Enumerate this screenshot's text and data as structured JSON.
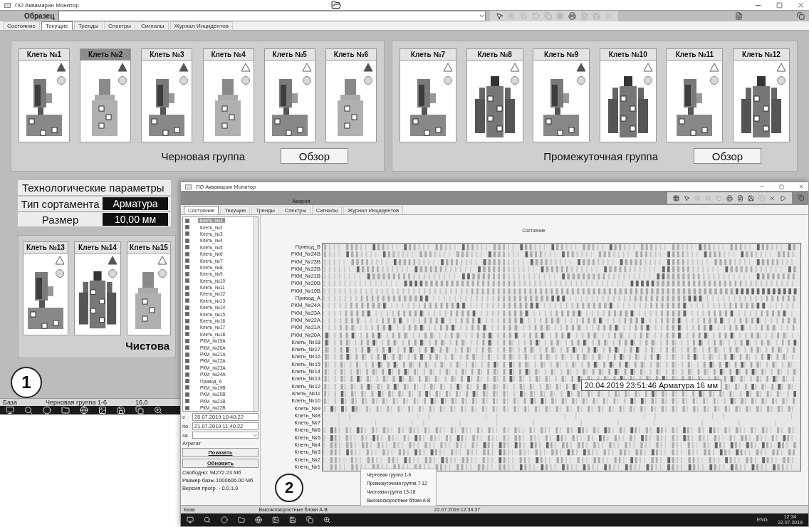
{
  "window1": {
    "title": "ПО Аквамарин Монитор",
    "sample_label": "Образец",
    "tabs": [
      {
        "label": "Состояние",
        "selected": false
      },
      {
        "label": "Текущие",
        "selected": true
      },
      {
        "label": "Тренды",
        "selected": false
      },
      {
        "label": "Спектры",
        "selected": false
      },
      {
        "label": "Сигналы",
        "selected": false
      },
      {
        "label": "Журнал Инцидентов",
        "selected": false
      }
    ],
    "groups": [
      {
        "name": "Черновая группа",
        "button": "Обзор",
        "stands": [
          {
            "label": "Клеть №1",
            "kind": "horizontal",
            "selected": false,
            "alarm": true
          },
          {
            "label": "Клеть №2",
            "kind": "vertical",
            "selected": true,
            "alarm": true
          },
          {
            "label": "Клеть №3",
            "kind": "horizontal",
            "selected": false,
            "alarm": true
          },
          {
            "label": "Клеть №4",
            "kind": "vertical",
            "selected": false,
            "alarm": false
          },
          {
            "label": "Клеть №5",
            "kind": "horizontal",
            "selected": false,
            "alarm": false
          },
          {
            "label": "Клеть №6",
            "kind": "vertical",
            "selected": false,
            "alarm": true
          }
        ]
      },
      {
        "name": "Промежуточная группа",
        "button": "Обзор",
        "stands": [
          {
            "label": "Клеть №7",
            "kind": "horizontal",
            "selected": false,
            "alarm": false
          },
          {
            "label": "Клеть №8",
            "kind": "frame",
            "selected": false,
            "alarm": false
          },
          {
            "label": "Клеть №9",
            "kind": "horizontal",
            "selected": false,
            "alarm": true
          },
          {
            "label": "Клеть №10",
            "kind": "frame",
            "selected": false,
            "alarm": false
          },
          {
            "label": "Клеть №11",
            "kind": "horizontal",
            "selected": false,
            "alarm": false
          },
          {
            "label": "Клеть №12",
            "kind": "frame",
            "selected": false,
            "alarm": false
          }
        ]
      }
    ],
    "params": {
      "title": "Технологические параметры",
      "rows": [
        {
          "label": "Тип сортамента",
          "value": "Арматура"
        },
        {
          "label": "Размер",
          "value": "10,00 мм"
        }
      ]
    },
    "finish_group": {
      "name": "Чистова",
      "stands": [
        {
          "label": "Клеть №13",
          "kind": "horizontal",
          "selected": false,
          "alarm": false
        },
        {
          "label": "Клеть №14",
          "kind": "frame",
          "selected": false,
          "alarm": true
        },
        {
          "label": "Клеть №15",
          "kind": "vertical",
          "selected": false,
          "alarm": false
        }
      ]
    },
    "marker": "1",
    "status_bar": [
      "База",
      "Черновая группа 1-6",
      "16.0"
    ]
  },
  "window2": {
    "title": "ПО Аквамарин Монитор",
    "header_text": "Авария",
    "tabs": [
      {
        "label": "Состояние",
        "selected": true
      },
      {
        "label": "Текущие",
        "selected": false
      },
      {
        "label": "Тренды",
        "selected": false
      },
      {
        "label": "Спектры",
        "selected": false
      },
      {
        "label": "Сигналы",
        "selected": false
      },
      {
        "label": "Журнал Инцидентов",
        "selected": false
      }
    ],
    "list": [
      {
        "label": "Клеть_№1",
        "checked": true,
        "selected": true
      },
      {
        "label": "Клеть_№2",
        "checked": true,
        "selected": false
      },
      {
        "label": "Клеть_№3",
        "checked": true,
        "selected": false
      },
      {
        "label": "Клеть_№4",
        "checked": true,
        "selected": false
      },
      {
        "label": "Клеть_№5",
        "checked": true,
        "selected": false
      },
      {
        "label": "Клеть_№6",
        "checked": true,
        "selected": false
      },
      {
        "label": "Клеть_№7",
        "checked": true,
        "selected": false
      },
      {
        "label": "Клеть_№8",
        "checked": true,
        "selected": false
      },
      {
        "label": "Клеть_№9",
        "checked": true,
        "selected": false
      },
      {
        "label": "Клеть_№10",
        "checked": true,
        "selected": false
      },
      {
        "label": "Клеть_№11",
        "checked": true,
        "selected": false
      },
      {
        "label": "Клеть_№12",
        "checked": true,
        "selected": false
      },
      {
        "label": "Клеть_№13",
        "checked": true,
        "selected": false
      },
      {
        "label": "Клеть_№14",
        "checked": true,
        "selected": false
      },
      {
        "label": "Клеть_№15",
        "checked": true,
        "selected": false
      },
      {
        "label": "Клеть_№16",
        "checked": true,
        "selected": false
      },
      {
        "label": "Клеть_№17",
        "checked": true,
        "selected": false
      },
      {
        "label": "Клеть_№18",
        "checked": true,
        "selected": false
      },
      {
        "label": "РКМ_№19А",
        "checked": true,
        "selected": false
      },
      {
        "label": "РКМ_№20А",
        "checked": true,
        "selected": false
      },
      {
        "label": "РКМ_№21А",
        "checked": true,
        "selected": false
      },
      {
        "label": "РКМ_№22А",
        "checked": true,
        "selected": false
      },
      {
        "label": "РКМ_№23А",
        "checked": true,
        "selected": false
      },
      {
        "label": "РКМ_№24А",
        "checked": true,
        "selected": false
      },
      {
        "label": "Привод_А",
        "checked": true,
        "selected": false
      },
      {
        "label": "РКМ_№19В",
        "checked": true,
        "selected": false
      },
      {
        "label": "РКМ_№20В",
        "checked": true,
        "selected": false
      },
      {
        "label": "РКМ_№21В",
        "checked": true,
        "selected": false
      },
      {
        "label": "РКМ_№22В",
        "checked": true,
        "selected": false
      }
    ],
    "from_label": "с",
    "from_value": "20.07.2019 10:40:22",
    "to_label": "по",
    "to_value": "21.07.2019 11:40:22",
    "period_label": "за",
    "unit_label": "Агрегат",
    "buttons": [
      "Показать",
      "Обновить"
    ],
    "info": [
      "Свободно: 94272.23 Мб",
      "Размер базы 1000606.00 Мб",
      "Версия прогр. - 0.0.1.0"
    ],
    "chart_title": "Состояние",
    "rows": [
      "Привод_В",
      "РКМ_№24В",
      "РКМ_№23В",
      "РКМ_№22В",
      "РКМ_№21В",
      "РКМ_№20В",
      "РКМ_№19В",
      "Привод_А",
      "РКМ_№24А",
      "РКМ_№23А",
      "РКМ_№22А",
      "РКМ_№21А",
      "РКМ_№20А",
      "Клеть_№18",
      "Клеть_№17",
      "Клеть_№16",
      "Клеть_№15",
      "Клеть_№14",
      "Клеть_№13",
      "Клеть_№12",
      "Клеть_№11",
      "Клеть_№10",
      "Клеть_№9",
      "Клеть_№8",
      "Клеть_№7",
      "Клеть_№6",
      "Клеть_№5",
      "Клеть_№4",
      "Клеть_№3",
      "Клеть_№2",
      "Клеть_№1"
    ],
    "tooltip": "20.04.2019 23:51:46 Арматура 16 мм",
    "marker": "2",
    "menu": [
      "Черновая группа 1-6",
      "Промежуточная группа 7-12",
      "Чистовая группа 13-18",
      "Высокоскоростные блоки А-В"
    ],
    "status_bar": [
      "База",
      "Высокоскоростные блоки А-В",
      "22.07.2019 12:34:37"
    ],
    "tray": {
      "lang": "ENG",
      "time": "12:34",
      "date": "22.07.2019"
    }
  }
}
